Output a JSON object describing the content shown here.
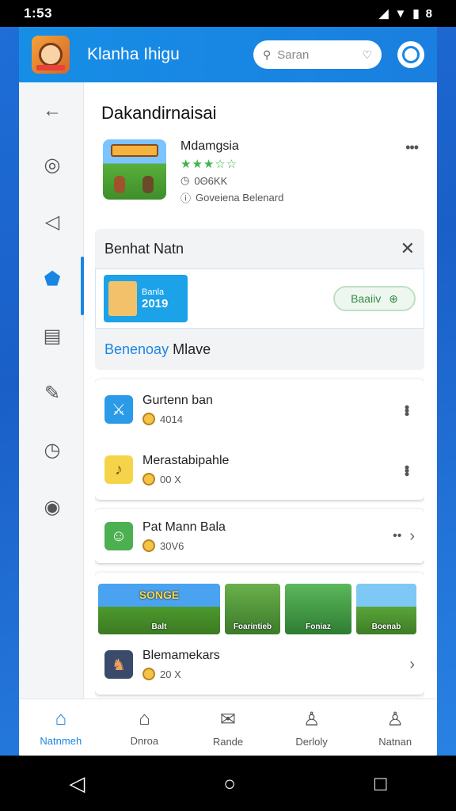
{
  "status": {
    "time": "1:53",
    "battery": "8"
  },
  "header": {
    "title": "Klanha Ihigu",
    "search_placeholder": "Saran"
  },
  "page": {
    "title": "Dakandirnaisai"
  },
  "game": {
    "name": "Mdamgsia",
    "stars": "★★★☆☆",
    "count": "0Θ6ΚΚ",
    "dev": "Goveiena Belenard"
  },
  "panel": {
    "title": "Benhat Natn",
    "promo_label": "Banla",
    "promo_year": "2019",
    "get_label": "Baaiiv",
    "sub_highlight": "Benenoay",
    "sub_text": "Mlave"
  },
  "list1": [
    {
      "title": "Gurtenn ban",
      "meta": "4014"
    },
    {
      "title": "Merastabipahle",
      "meta": "00 Χ"
    }
  ],
  "list2": {
    "title": "Pat Mann Bala",
    "meta": "30V6"
  },
  "banners": [
    {
      "top": "SONGE",
      "label": "Balt"
    },
    {
      "top": "",
      "label": "Foarintieb"
    },
    {
      "top": "",
      "label": "Foniaz"
    },
    {
      "top": "",
      "label": "Boenab"
    }
  ],
  "list3": {
    "title": "Blemamekars",
    "meta": "20 Χ"
  },
  "nav": [
    {
      "label": "Natnmeh",
      "icon": "⌂"
    },
    {
      "label": "Dnroa",
      "icon": "⌂"
    },
    {
      "label": "Rande",
      "icon": "✉"
    },
    {
      "label": "Derloly",
      "icon": "♙"
    },
    {
      "label": "Natnan",
      "icon": "♙"
    }
  ],
  "colors": {
    "accent": "#1a86e4",
    "appbar": "#168ee6"
  }
}
